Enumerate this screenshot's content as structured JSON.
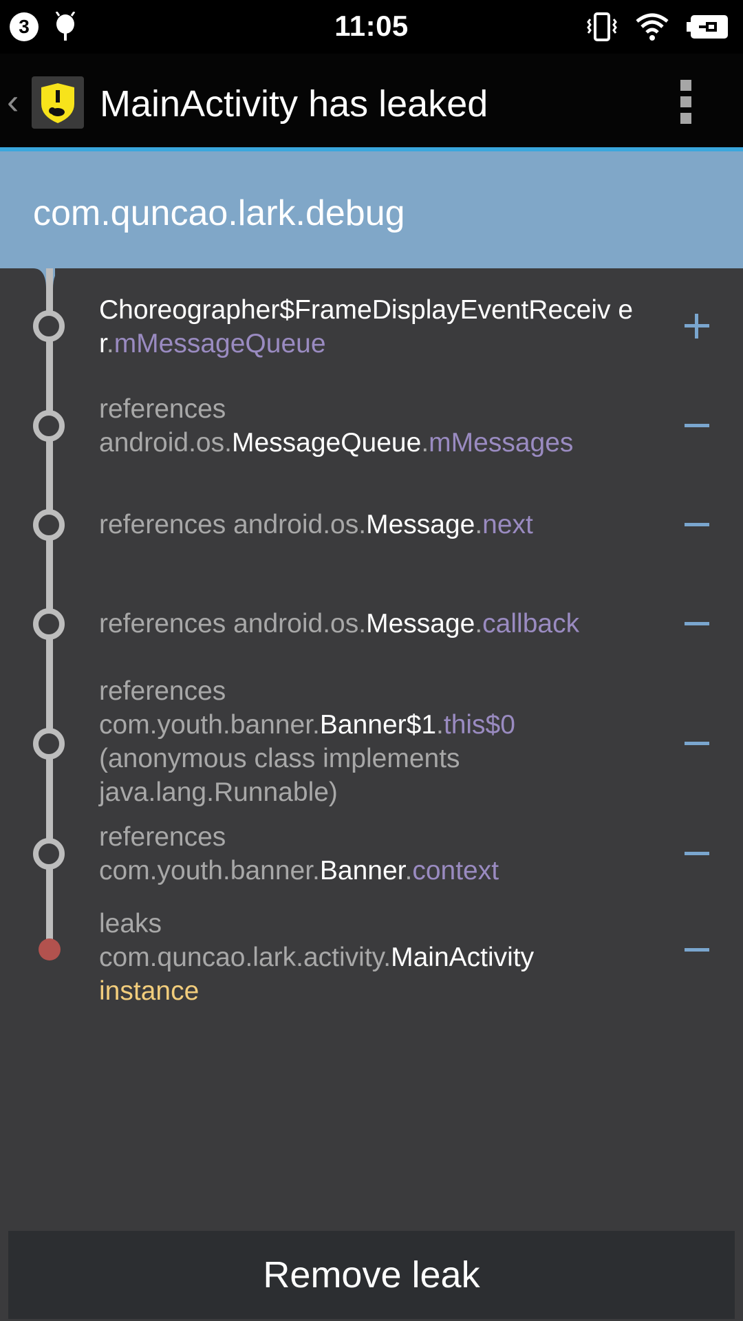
{
  "status_bar": {
    "notification_count": "3",
    "time": "11:05",
    "icons": [
      "debug-bug-icon",
      "vibrate-icon",
      "wifi-icon",
      "battery-charging-icon"
    ]
  },
  "action_bar": {
    "title": "MainActivity has leaked",
    "app_icon": "leakcanary-icon",
    "accent_color": "#3aa7dd"
  },
  "package_header": {
    "name": "com.quncao.lark.debug",
    "background": "#80a7c8"
  },
  "trace": [
    {
      "parts": [
        {
          "text": "Choreographer$FrameDisplayEventReceiv er",
          "style": "white"
        },
        {
          "text": ".",
          "style": "grey"
        },
        {
          "text": "mMessageQueue",
          "style": "purple"
        }
      ],
      "toggle": "plus"
    },
    {
      "parts": [
        {
          "text": "references ",
          "style": "grey"
        },
        {
          "text": "android.os.",
          "style": "grey"
        },
        {
          "text": "MessageQueue",
          "style": "white"
        },
        {
          "text": ".",
          "style": "grey"
        },
        {
          "text": "mMessages",
          "style": "purple"
        }
      ],
      "toggle": "minus"
    },
    {
      "parts": [
        {
          "text": "references ",
          "style": "grey"
        },
        {
          "text": "android.os.",
          "style": "grey"
        },
        {
          "text": "Message",
          "style": "white"
        },
        {
          "text": ".",
          "style": "grey"
        },
        {
          "text": "next",
          "style": "purple"
        }
      ],
      "toggle": "minus"
    },
    {
      "parts": [
        {
          "text": "references ",
          "style": "grey"
        },
        {
          "text": "android.os.",
          "style": "grey"
        },
        {
          "text": "Message",
          "style": "white"
        },
        {
          "text": ".",
          "style": "grey"
        },
        {
          "text": "callback",
          "style": "purple"
        }
      ],
      "toggle": "minus"
    },
    {
      "parts": [
        {
          "text": "references ",
          "style": "grey"
        },
        {
          "text": "com.youth.banner.",
          "style": "grey"
        },
        {
          "text": "Banner$1",
          "style": "white"
        },
        {
          "text": ".",
          "style": "grey"
        },
        {
          "text": "this$0",
          "style": "purple"
        },
        {
          "text": " (anonymous class implements java.lang.Runnable)",
          "style": "grey"
        }
      ],
      "toggle": "minus"
    },
    {
      "parts": [
        {
          "text": "references ",
          "style": "grey"
        },
        {
          "text": "com.youth.banner.",
          "style": "grey"
        },
        {
          "text": "Banner",
          "style": "white"
        },
        {
          "text": ".",
          "style": "grey"
        },
        {
          "text": "context",
          "style": "purple"
        }
      ],
      "toggle": "minus"
    },
    {
      "parts": [
        {
          "text": "leaks ",
          "style": "grey"
        },
        {
          "text": "com.quncao.lark.activity.",
          "style": "grey"
        },
        {
          "text": "MainActivity",
          "style": "white"
        },
        {
          "text": " instance",
          "style": "yellow"
        }
      ],
      "toggle": "minus",
      "leak": true
    }
  ],
  "remove_button_label": "Remove leak"
}
